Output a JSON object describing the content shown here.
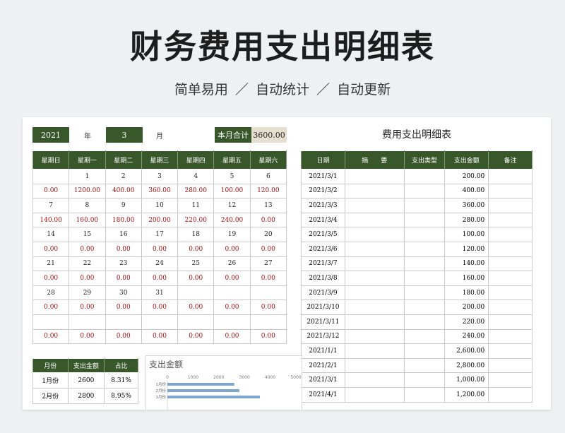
{
  "hero": {
    "title": "财务费用支出明细表",
    "subtitle": "简单易用  ／  自动统计  ／  自动更新"
  },
  "header": {
    "year": "2021",
    "year_unit": "年",
    "month": "3",
    "month_unit": "月",
    "total_label": "本月合计",
    "total_value": "3600.00"
  },
  "calendar": {
    "weekdays": [
      "星期日",
      "星期一",
      "星期二",
      "星期三",
      "星期四",
      "星期五",
      "星期六"
    ],
    "weeks": [
      {
        "days": [
          "",
          "1",
          "2",
          "3",
          "4",
          "5",
          "6"
        ],
        "amounts": [
          "0.00",
          "1200.00",
          "400.00",
          "360.00",
          "280.00",
          "100.00",
          "120.00"
        ]
      },
      {
        "days": [
          "7",
          "8",
          "9",
          "10",
          "11",
          "12",
          "13"
        ],
        "amounts": [
          "140.00",
          "160.00",
          "180.00",
          "200.00",
          "220.00",
          "240.00",
          "0.00"
        ]
      },
      {
        "days": [
          "14",
          "15",
          "16",
          "17",
          "18",
          "19",
          "20"
        ],
        "amounts": [
          "0.00",
          "0.00",
          "0.00",
          "0.00",
          "0.00",
          "0.00",
          "0.00"
        ]
      },
      {
        "days": [
          "21",
          "22",
          "23",
          "24",
          "25",
          "26",
          "27"
        ],
        "amounts": [
          "0.00",
          "0.00",
          "0.00",
          "0.00",
          "0.00",
          "0.00",
          "0.00"
        ]
      },
      {
        "days": [
          "28",
          "29",
          "30",
          "31",
          "",
          "",
          ""
        ],
        "amounts": [
          "0.00",
          "0.00",
          "0.00",
          "0.00",
          "0.00",
          "0.00",
          "0.00"
        ]
      },
      {
        "days": [
          "",
          "",
          "",
          "",
          "",
          "",
          ""
        ],
        "amounts": [
          "0.00",
          "0.00",
          "0.00",
          "0.00",
          "0.00",
          "0.00",
          "0.00"
        ]
      }
    ]
  },
  "expenses": {
    "title": "费用支出明细表",
    "columns": [
      "日期",
      "摘　　要",
      "支出类型",
      "支出金额",
      "备注"
    ],
    "rows": [
      [
        "2021/3/1",
        "",
        "",
        "200.00",
        ""
      ],
      [
        "2021/3/2",
        "",
        "",
        "400.00",
        ""
      ],
      [
        "2021/3/3",
        "",
        "",
        "360.00",
        ""
      ],
      [
        "2021/3/4",
        "",
        "",
        "280.00",
        ""
      ],
      [
        "2021/3/5",
        "",
        "",
        "100.00",
        ""
      ],
      [
        "2021/3/6",
        "",
        "",
        "120.00",
        ""
      ],
      [
        "2021/3/7",
        "",
        "",
        "140.00",
        ""
      ],
      [
        "2021/3/8",
        "",
        "",
        "160.00",
        ""
      ],
      [
        "2021/3/9",
        "",
        "",
        "180.00",
        ""
      ],
      [
        "2021/3/10",
        "",
        "",
        "200.00",
        ""
      ],
      [
        "2021/3/11",
        "",
        "",
        "220.00",
        ""
      ],
      [
        "2021/3/12",
        "",
        "",
        "240.00",
        ""
      ],
      [
        "2021/1/1",
        "",
        "",
        "2,600.00",
        ""
      ],
      [
        "2021/2/1",
        "",
        "",
        "2,800.00",
        ""
      ],
      [
        "2021/3/1",
        "",
        "",
        "1,000.00",
        ""
      ],
      [
        "2021/4/1",
        "",
        "",
        "1,200.00",
        ""
      ]
    ]
  },
  "monthly": {
    "columns": [
      "月份",
      "支出金额",
      "占比"
    ],
    "rows": [
      [
        "1月份",
        "2600",
        "8.31%"
      ],
      [
        "2月份",
        "2800",
        "8.95%"
      ]
    ]
  },
  "chart_data": {
    "type": "bar",
    "orientation": "horizontal",
    "title": "支出金额",
    "categories": [
      "1月份",
      "2月份",
      "3月份"
    ],
    "values": [
      2600,
      2800,
      3600
    ],
    "xlim": [
      0,
      5000
    ],
    "ticks": [
      "0",
      "1000",
      "2000",
      "3000",
      "4000",
      "5000"
    ],
    "bar_color": "#7ea6cf"
  }
}
